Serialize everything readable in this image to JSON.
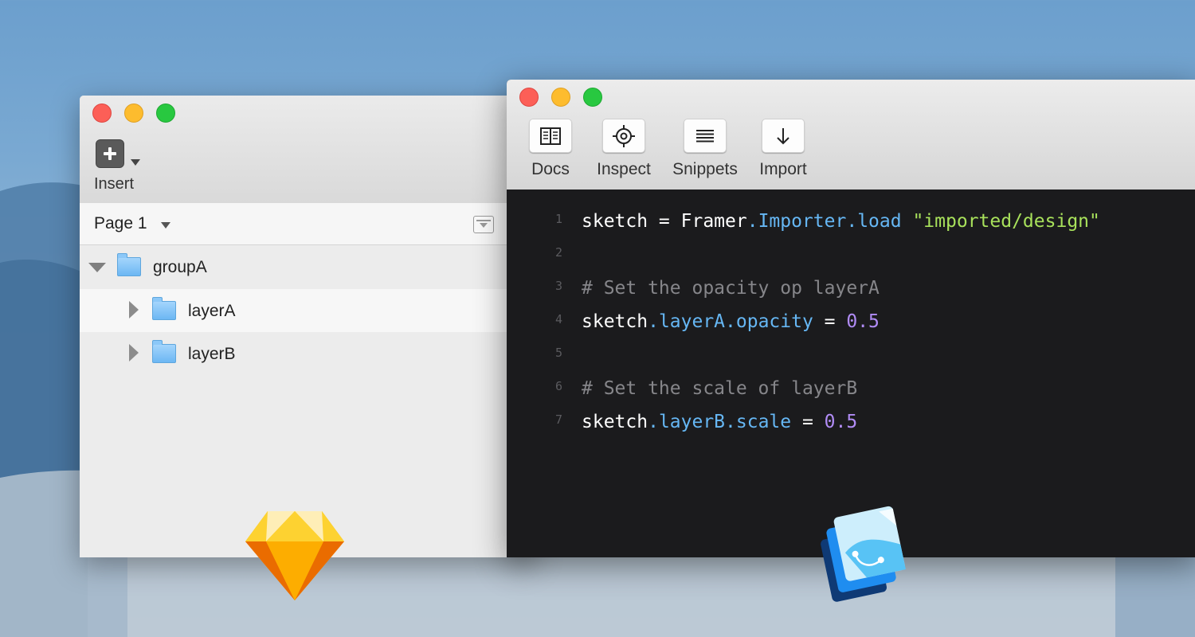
{
  "sketch_window": {
    "toolbar": {
      "insert_label": "Insert"
    },
    "page_selector": {
      "label": "Page 1"
    },
    "layers": [
      {
        "name": "groupA",
        "type": "group",
        "expanded": true
      },
      {
        "name": "layerA",
        "type": "group",
        "expanded": false
      },
      {
        "name": "layerB",
        "type": "group",
        "expanded": false
      }
    ]
  },
  "framer_window": {
    "toolbar": [
      {
        "label": "Docs",
        "icon": "book-icon"
      },
      {
        "label": "Inspect",
        "icon": "crosshair-icon"
      },
      {
        "label": "Snippets",
        "icon": "lines-icon"
      },
      {
        "label": "Import",
        "icon": "arrow-down-icon"
      }
    ],
    "code": [
      {
        "num": "1",
        "tokens": [
          {
            "t": "sketch = Framer",
            "c": "plain"
          },
          {
            "t": ".Importer.load",
            "c": "prop"
          },
          {
            "t": " ",
            "c": "plain"
          },
          {
            "t": "\"imported/design\"",
            "c": "str"
          }
        ]
      },
      {
        "num": "2",
        "tokens": []
      },
      {
        "num": "3",
        "tokens": [
          {
            "t": "# Set the opacity op layerA",
            "c": "com"
          }
        ]
      },
      {
        "num": "4",
        "tokens": [
          {
            "t": "sketch",
            "c": "plain"
          },
          {
            "t": ".layerA.opacity",
            "c": "prop"
          },
          {
            "t": " = ",
            "c": "plain"
          },
          {
            "t": "0.5",
            "c": "num"
          }
        ]
      },
      {
        "num": "5",
        "tokens": []
      },
      {
        "num": "6",
        "tokens": [
          {
            "t": "# Set the scale of layerB",
            "c": "com"
          }
        ]
      },
      {
        "num": "7",
        "tokens": [
          {
            "t": "sketch",
            "c": "plain"
          },
          {
            "t": ".layerB.scale",
            "c": "prop"
          },
          {
            "t": " = ",
            "c": "plain"
          },
          {
            "t": "0.5",
            "c": "num"
          }
        ]
      }
    ]
  },
  "colors": {
    "code_background": "#1b1b1d",
    "code_property": "#66b7f4",
    "code_string": "#a8e15b",
    "code_number": "#b18cf6",
    "code_comment": "#86868a",
    "sketch_icon": "#f7a624",
    "framer_icon": "#1f8df0"
  }
}
